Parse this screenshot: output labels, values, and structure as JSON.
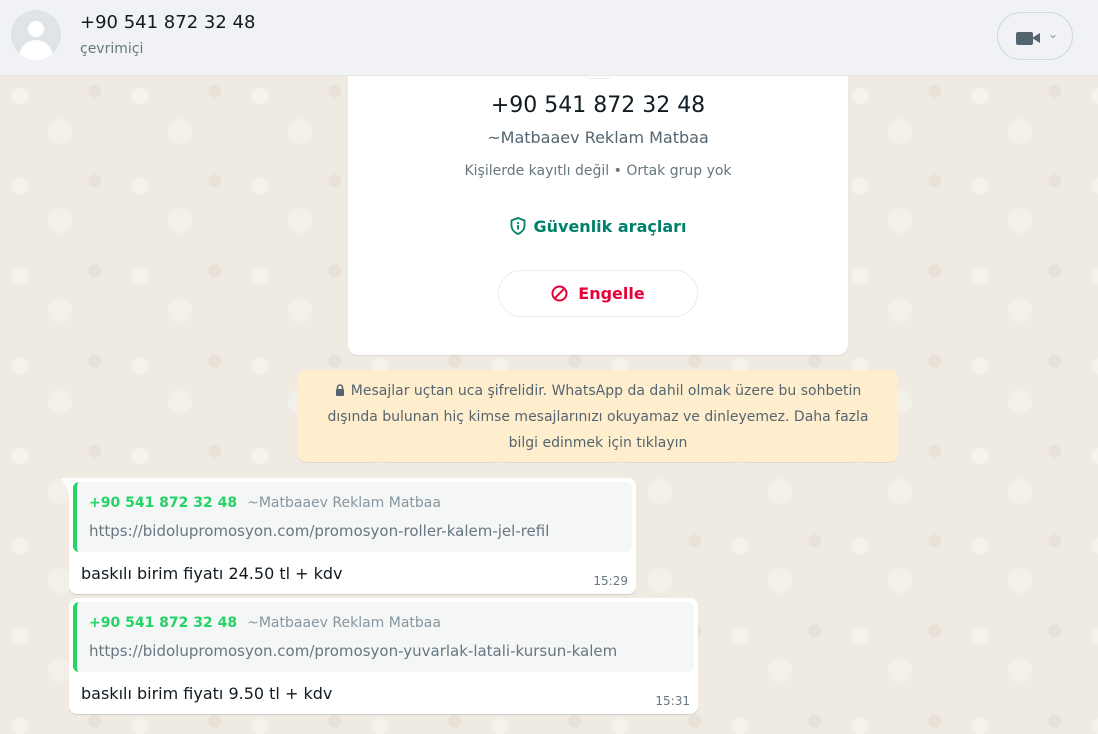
{
  "header": {
    "title": "+90 541 872 32 48",
    "status": "çevrimiçi",
    "video_icon": "video-camera-icon",
    "chevron": "⌄"
  },
  "contact_card": {
    "phone": "+90 541 872 32 48",
    "name": "~Matbaaev Reklam Matbaa",
    "meta": "Kişilerde kayıtlı değil • Ortak grup yok",
    "security_label": "Güvenlik araçları",
    "block_label": "Engelle"
  },
  "notice": {
    "text": "Mesajlar uçtan uca şifrelidir. WhatsApp da dahil olmak üzere bu sohbetin dışında bulunan hiç kimse mesajlarınızı okuyamaz ve dinleyemez. Daha fazla bilgi edinmek için tıklayın"
  },
  "messages": [
    {
      "quote_phone": "+90 541 872 32 48",
      "quote_name": "~Matbaaev Reklam Matbaa",
      "quote_text": "https://bidolupromosyon.com/promosyon-roller-kalem-jel-refil",
      "text": "baskılı birim fiyatı 24.50 tl + kdv",
      "time": "15:29"
    },
    {
      "quote_phone": "+90 541 872 32 48",
      "quote_name": "~Matbaaev Reklam Matbaa",
      "quote_text": "https://bidolupromosyon.com/promosyon-yuvarlak-latali-kursun-kalem",
      "text": "baskılı birim fiyatı 9.50 tl + kdv",
      "time": "15:31"
    }
  ],
  "colors": {
    "accent": "#008069",
    "quote_accent": "#25d366",
    "danger": "#ea0038",
    "notice_bg": "#ffeecd",
    "chat_bg": "#efeae2"
  }
}
